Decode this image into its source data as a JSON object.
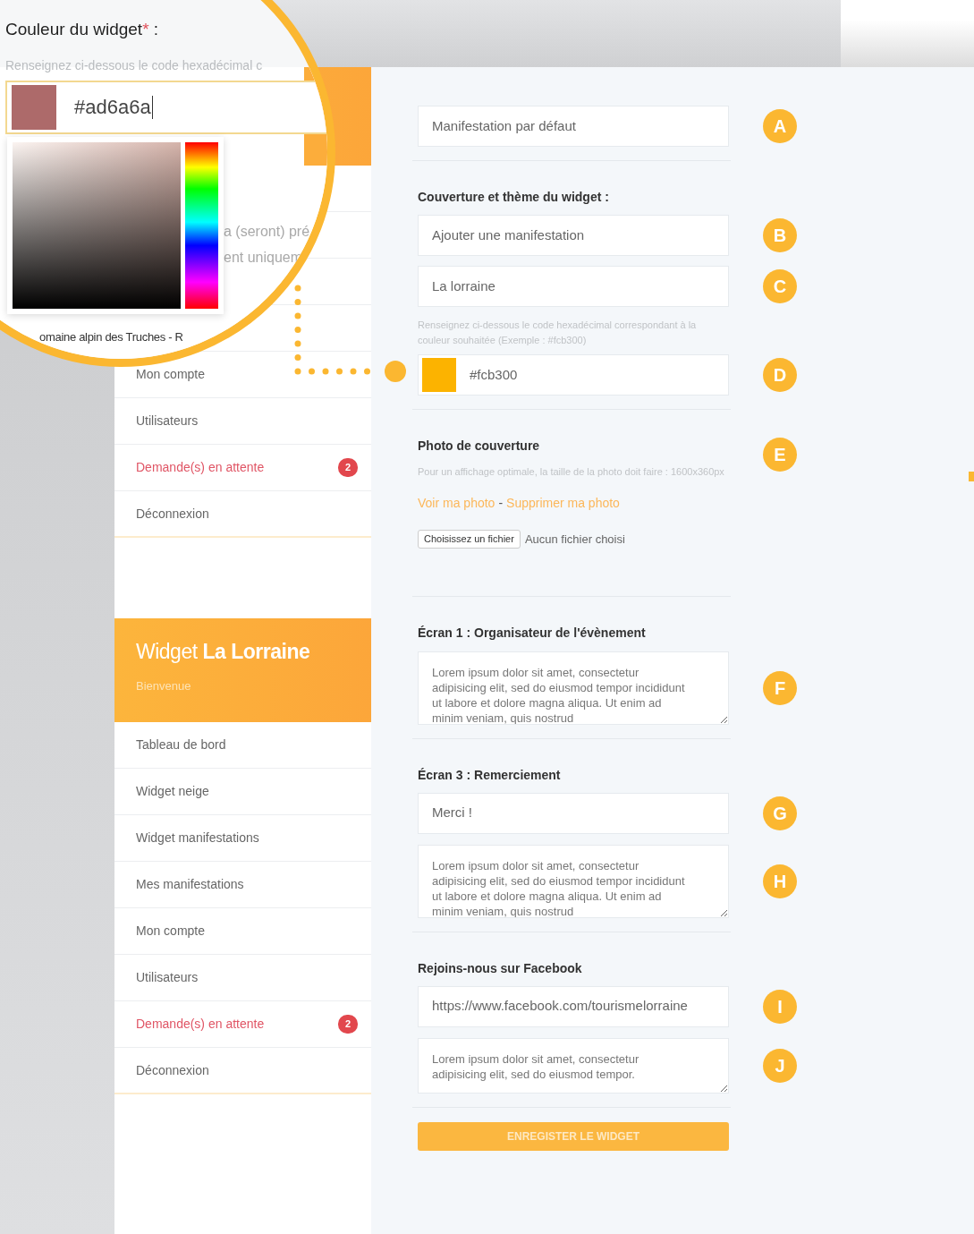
{
  "magnifier": {
    "label": "Couleur du widget",
    "required_mark": "*",
    "label_end": ":",
    "hint": "Renseignez ci-dessous le code hexadécimal c",
    "value": "#ad6a6a",
    "picker_open": true,
    "fragments": [
      "a (seront) pré",
      "ent uniquem",
      "omaine alpin des Truches - R"
    ]
  },
  "sidebar_top": {
    "items": [
      {
        "label": "Mon compte",
        "kind": "link"
      },
      {
        "label": "Utilisateurs",
        "kind": "link"
      },
      {
        "label": "Demande(s) en attente",
        "kind": "alert",
        "badge": "2"
      },
      {
        "label": "Déconnexion",
        "kind": "link"
      }
    ]
  },
  "sidebar_bottom": {
    "title": "Widget **La Lorraine**",
    "subtitle": "Bienvenue",
    "items": [
      {
        "label": "Tableau de bord",
        "kind": "link"
      },
      {
        "label": "Widget neige",
        "kind": "link"
      },
      {
        "label": "Widget manifestations",
        "kind": "link"
      },
      {
        "label": "Mes manifestations",
        "kind": "link"
      },
      {
        "label": "Mon compte",
        "kind": "link"
      },
      {
        "label": "Utilisateurs",
        "kind": "link"
      },
      {
        "label": "Demande(s) en attente",
        "kind": "alert",
        "badge": "2"
      },
      {
        "label": "Déconnexion",
        "kind": "link"
      }
    ]
  },
  "form": {
    "sections": [
      {
        "items": [
          {
            "kind": "input",
            "value": "Manifestation par défaut",
            "callout": "A"
          }
        ]
      },
      {
        "items": [
          {
            "kind": "heading",
            "text": "Couverture et thème du widget :"
          },
          {
            "kind": "input",
            "value": "Ajouter une manifestation",
            "callout": "B"
          },
          {
            "kind": "input",
            "value": "La lorraine",
            "callout": "C"
          },
          {
            "kind": "hint",
            "text": "Renseignez ci-dessous le code hexadécimal correspondant à la couleur souhaitée (Exemple : #fcb300)"
          },
          {
            "kind": "color",
            "value": "#fcb300",
            "callout": "D"
          }
        ]
      },
      {
        "items": [
          {
            "kind": "heading",
            "text": "Photo de couverture",
            "callout": "E"
          },
          {
            "kind": "hint",
            "text": "Pour un affichage optimale, la taille de la photo doit faire : 1600x360px"
          },
          {
            "kind": "links",
            "links": [
              "Voir ma photo",
              "Supprimer ma photo"
            ],
            "separator": "-"
          },
          {
            "kind": "file",
            "button": "Choisissez un fichier",
            "status": "Aucun fichier choisi"
          }
        ]
      },
      {
        "items": [
          {
            "kind": "heading",
            "text": "Écran 1 : Organisateur de l'évènement"
          },
          {
            "kind": "textarea",
            "value": "Lorem ipsum dolor sit amet, consectetur adipisicing elit, sed do eiusmod tempor incididunt ut labore et dolore magna aliqua. Ut enim ad minim veniam, quis nostrud",
            "callout": "F"
          }
        ]
      },
      {
        "items": [
          {
            "kind": "heading",
            "text": "Écran 3 : Remerciement"
          },
          {
            "kind": "input",
            "value": "Merci !",
            "callout": "G"
          },
          {
            "kind": "textarea",
            "value": "Lorem ipsum dolor sit amet, consectetur adipisicing elit, sed do eiusmod tempor incididunt ut labore et dolore magna aliqua. Ut enim ad minim veniam, quis nostrud",
            "callout": "H"
          }
        ]
      },
      {
        "items": [
          {
            "kind": "heading",
            "text": "Rejoins-nous sur Facebook"
          },
          {
            "kind": "input",
            "value": "https://www.facebook.com/tourismelorraine",
            "callout": "I"
          },
          {
            "kind": "textarea",
            "value": "Lorem ipsum dolor sit amet, consectetur adipisicing elit, sed do eiusmod tempor.",
            "callout": "J",
            "short": true
          }
        ]
      }
    ],
    "submit": "ENREGISTER LE WIDGET"
  }
}
